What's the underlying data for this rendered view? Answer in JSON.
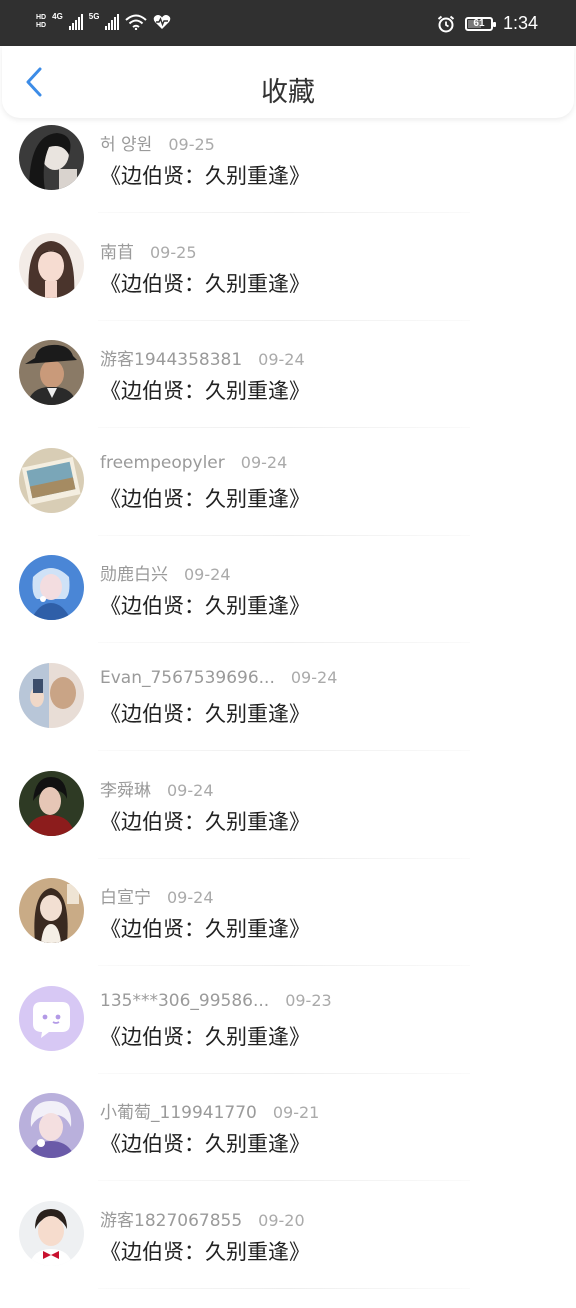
{
  "status_bar": {
    "left_indicators": [
      "HD",
      "4G",
      "5G",
      "wifi-icon",
      "heart-rate-icon"
    ],
    "battery": "61",
    "battery_level": 0.61,
    "time": "1:34"
  },
  "header": {
    "title": "收藏",
    "back_icon": "chevron-left-icon",
    "accent_color": "#3c8ce7"
  },
  "favorites": [
    {
      "name": "허 양원",
      "date": "09-25",
      "work": "《边伯贤：久别重逢》",
      "avatar": "avatar-dark-portrait"
    },
    {
      "name": "南苜",
      "date": "09-25",
      "work": "《边伯贤：久别重逢》",
      "avatar": "avatar-girl-portrait"
    },
    {
      "name": "游客1944358381",
      "date": "09-24",
      "work": "《边伯贤：久别重逢》",
      "avatar": "avatar-man-hat"
    },
    {
      "name": "freempeopyler",
      "date": "09-24",
      "work": "《边伯贤：久别重逢》",
      "avatar": "avatar-photo-frame"
    },
    {
      "name": "勋鹿白兴",
      "date": "09-24",
      "work": "《边伯贤：久别重逢》",
      "avatar": "avatar-blue-stage"
    },
    {
      "name": "Evan_7567539696...",
      "date": "09-24",
      "work": "《边伯贤：久别重逢》",
      "avatar": "avatar-couple"
    },
    {
      "name": "李舜琳",
      "date": "09-24",
      "work": "《边伯贤：久别重逢》",
      "avatar": "avatar-red-portrait"
    },
    {
      "name": "白宣宁",
      "date": "09-24",
      "work": "《边伯贤：久别重逢》",
      "avatar": "avatar-beige-portrait"
    },
    {
      "name": "135***306_99586...",
      "date": "09-23",
      "work": "《边伯贤：久别重逢》",
      "avatar": "avatar-default-chat"
    },
    {
      "name": "小葡萄_119941770",
      "date": "09-21",
      "work": "《边伯贤：久别重逢》",
      "avatar": "avatar-purple-portrait"
    },
    {
      "name": "游客1827067855",
      "date": "09-20",
      "work": "《边伯贤：久别重逢》",
      "avatar": "avatar-child-portrait"
    }
  ]
}
